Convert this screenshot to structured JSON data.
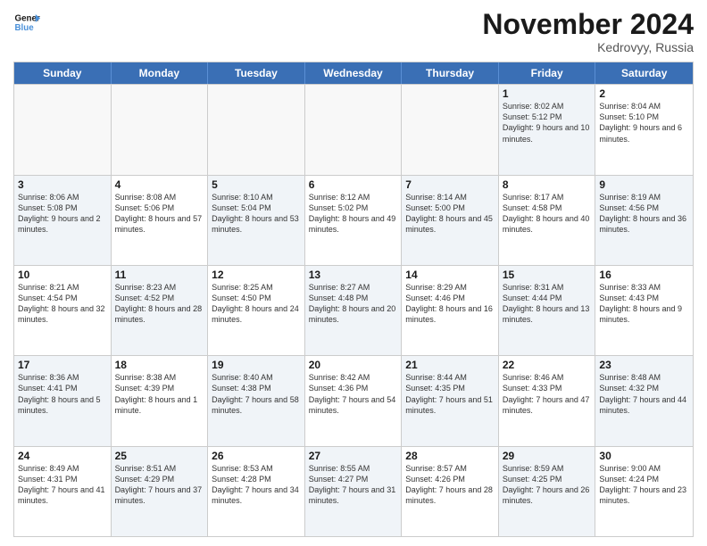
{
  "header": {
    "logo_general": "General",
    "logo_blue": "Blue",
    "month_title": "November 2024",
    "subtitle": "Kedrovyy, Russia"
  },
  "days_of_week": [
    "Sunday",
    "Monday",
    "Tuesday",
    "Wednesday",
    "Thursday",
    "Friday",
    "Saturday"
  ],
  "rows": [
    [
      {
        "day": "",
        "info": "",
        "shaded": false,
        "empty": true
      },
      {
        "day": "",
        "info": "",
        "shaded": false,
        "empty": true
      },
      {
        "day": "",
        "info": "",
        "shaded": false,
        "empty": true
      },
      {
        "day": "",
        "info": "",
        "shaded": false,
        "empty": true
      },
      {
        "day": "",
        "info": "",
        "shaded": false,
        "empty": true
      },
      {
        "day": "1",
        "info": "Sunrise: 8:02 AM\nSunset: 5:12 PM\nDaylight: 9 hours\nand 10 minutes.",
        "shaded": true,
        "empty": false
      },
      {
        "day": "2",
        "info": "Sunrise: 8:04 AM\nSunset: 5:10 PM\nDaylight: 9 hours\nand 6 minutes.",
        "shaded": false,
        "empty": false
      }
    ],
    [
      {
        "day": "3",
        "info": "Sunrise: 8:06 AM\nSunset: 5:08 PM\nDaylight: 9 hours\nand 2 minutes.",
        "shaded": true,
        "empty": false
      },
      {
        "day": "4",
        "info": "Sunrise: 8:08 AM\nSunset: 5:06 PM\nDaylight: 8 hours\nand 57 minutes.",
        "shaded": false,
        "empty": false
      },
      {
        "day": "5",
        "info": "Sunrise: 8:10 AM\nSunset: 5:04 PM\nDaylight: 8 hours\nand 53 minutes.",
        "shaded": true,
        "empty": false
      },
      {
        "day": "6",
        "info": "Sunrise: 8:12 AM\nSunset: 5:02 PM\nDaylight: 8 hours\nand 49 minutes.",
        "shaded": false,
        "empty": false
      },
      {
        "day": "7",
        "info": "Sunrise: 8:14 AM\nSunset: 5:00 PM\nDaylight: 8 hours\nand 45 minutes.",
        "shaded": true,
        "empty": false
      },
      {
        "day": "8",
        "info": "Sunrise: 8:17 AM\nSunset: 4:58 PM\nDaylight: 8 hours\nand 40 minutes.",
        "shaded": false,
        "empty": false
      },
      {
        "day": "9",
        "info": "Sunrise: 8:19 AM\nSunset: 4:56 PM\nDaylight: 8 hours\nand 36 minutes.",
        "shaded": true,
        "empty": false
      }
    ],
    [
      {
        "day": "10",
        "info": "Sunrise: 8:21 AM\nSunset: 4:54 PM\nDaylight: 8 hours\nand 32 minutes.",
        "shaded": false,
        "empty": false
      },
      {
        "day": "11",
        "info": "Sunrise: 8:23 AM\nSunset: 4:52 PM\nDaylight: 8 hours\nand 28 minutes.",
        "shaded": true,
        "empty": false
      },
      {
        "day": "12",
        "info": "Sunrise: 8:25 AM\nSunset: 4:50 PM\nDaylight: 8 hours\nand 24 minutes.",
        "shaded": false,
        "empty": false
      },
      {
        "day": "13",
        "info": "Sunrise: 8:27 AM\nSunset: 4:48 PM\nDaylight: 8 hours\nand 20 minutes.",
        "shaded": true,
        "empty": false
      },
      {
        "day": "14",
        "info": "Sunrise: 8:29 AM\nSunset: 4:46 PM\nDaylight: 8 hours\nand 16 minutes.",
        "shaded": false,
        "empty": false
      },
      {
        "day": "15",
        "info": "Sunrise: 8:31 AM\nSunset: 4:44 PM\nDaylight: 8 hours\nand 13 minutes.",
        "shaded": true,
        "empty": false
      },
      {
        "day": "16",
        "info": "Sunrise: 8:33 AM\nSunset: 4:43 PM\nDaylight: 8 hours\nand 9 minutes.",
        "shaded": false,
        "empty": false
      }
    ],
    [
      {
        "day": "17",
        "info": "Sunrise: 8:36 AM\nSunset: 4:41 PM\nDaylight: 8 hours\nand 5 minutes.",
        "shaded": true,
        "empty": false
      },
      {
        "day": "18",
        "info": "Sunrise: 8:38 AM\nSunset: 4:39 PM\nDaylight: 8 hours\nand 1 minute.",
        "shaded": false,
        "empty": false
      },
      {
        "day": "19",
        "info": "Sunrise: 8:40 AM\nSunset: 4:38 PM\nDaylight: 7 hours\nand 58 minutes.",
        "shaded": true,
        "empty": false
      },
      {
        "day": "20",
        "info": "Sunrise: 8:42 AM\nSunset: 4:36 PM\nDaylight: 7 hours\nand 54 minutes.",
        "shaded": false,
        "empty": false
      },
      {
        "day": "21",
        "info": "Sunrise: 8:44 AM\nSunset: 4:35 PM\nDaylight: 7 hours\nand 51 minutes.",
        "shaded": true,
        "empty": false
      },
      {
        "day": "22",
        "info": "Sunrise: 8:46 AM\nSunset: 4:33 PM\nDaylight: 7 hours\nand 47 minutes.",
        "shaded": false,
        "empty": false
      },
      {
        "day": "23",
        "info": "Sunrise: 8:48 AM\nSunset: 4:32 PM\nDaylight: 7 hours\nand 44 minutes.",
        "shaded": true,
        "empty": false
      }
    ],
    [
      {
        "day": "24",
        "info": "Sunrise: 8:49 AM\nSunset: 4:31 PM\nDaylight: 7 hours\nand 41 minutes.",
        "shaded": false,
        "empty": false
      },
      {
        "day": "25",
        "info": "Sunrise: 8:51 AM\nSunset: 4:29 PM\nDaylight: 7 hours\nand 37 minutes.",
        "shaded": true,
        "empty": false
      },
      {
        "day": "26",
        "info": "Sunrise: 8:53 AM\nSunset: 4:28 PM\nDaylight: 7 hours\nand 34 minutes.",
        "shaded": false,
        "empty": false
      },
      {
        "day": "27",
        "info": "Sunrise: 8:55 AM\nSunset: 4:27 PM\nDaylight: 7 hours\nand 31 minutes.",
        "shaded": true,
        "empty": false
      },
      {
        "day": "28",
        "info": "Sunrise: 8:57 AM\nSunset: 4:26 PM\nDaylight: 7 hours\nand 28 minutes.",
        "shaded": false,
        "empty": false
      },
      {
        "day": "29",
        "info": "Sunrise: 8:59 AM\nSunset: 4:25 PM\nDaylight: 7 hours\nand 26 minutes.",
        "shaded": true,
        "empty": false
      },
      {
        "day": "30",
        "info": "Sunrise: 9:00 AM\nSunset: 4:24 PM\nDaylight: 7 hours\nand 23 minutes.",
        "shaded": false,
        "empty": false
      }
    ]
  ]
}
